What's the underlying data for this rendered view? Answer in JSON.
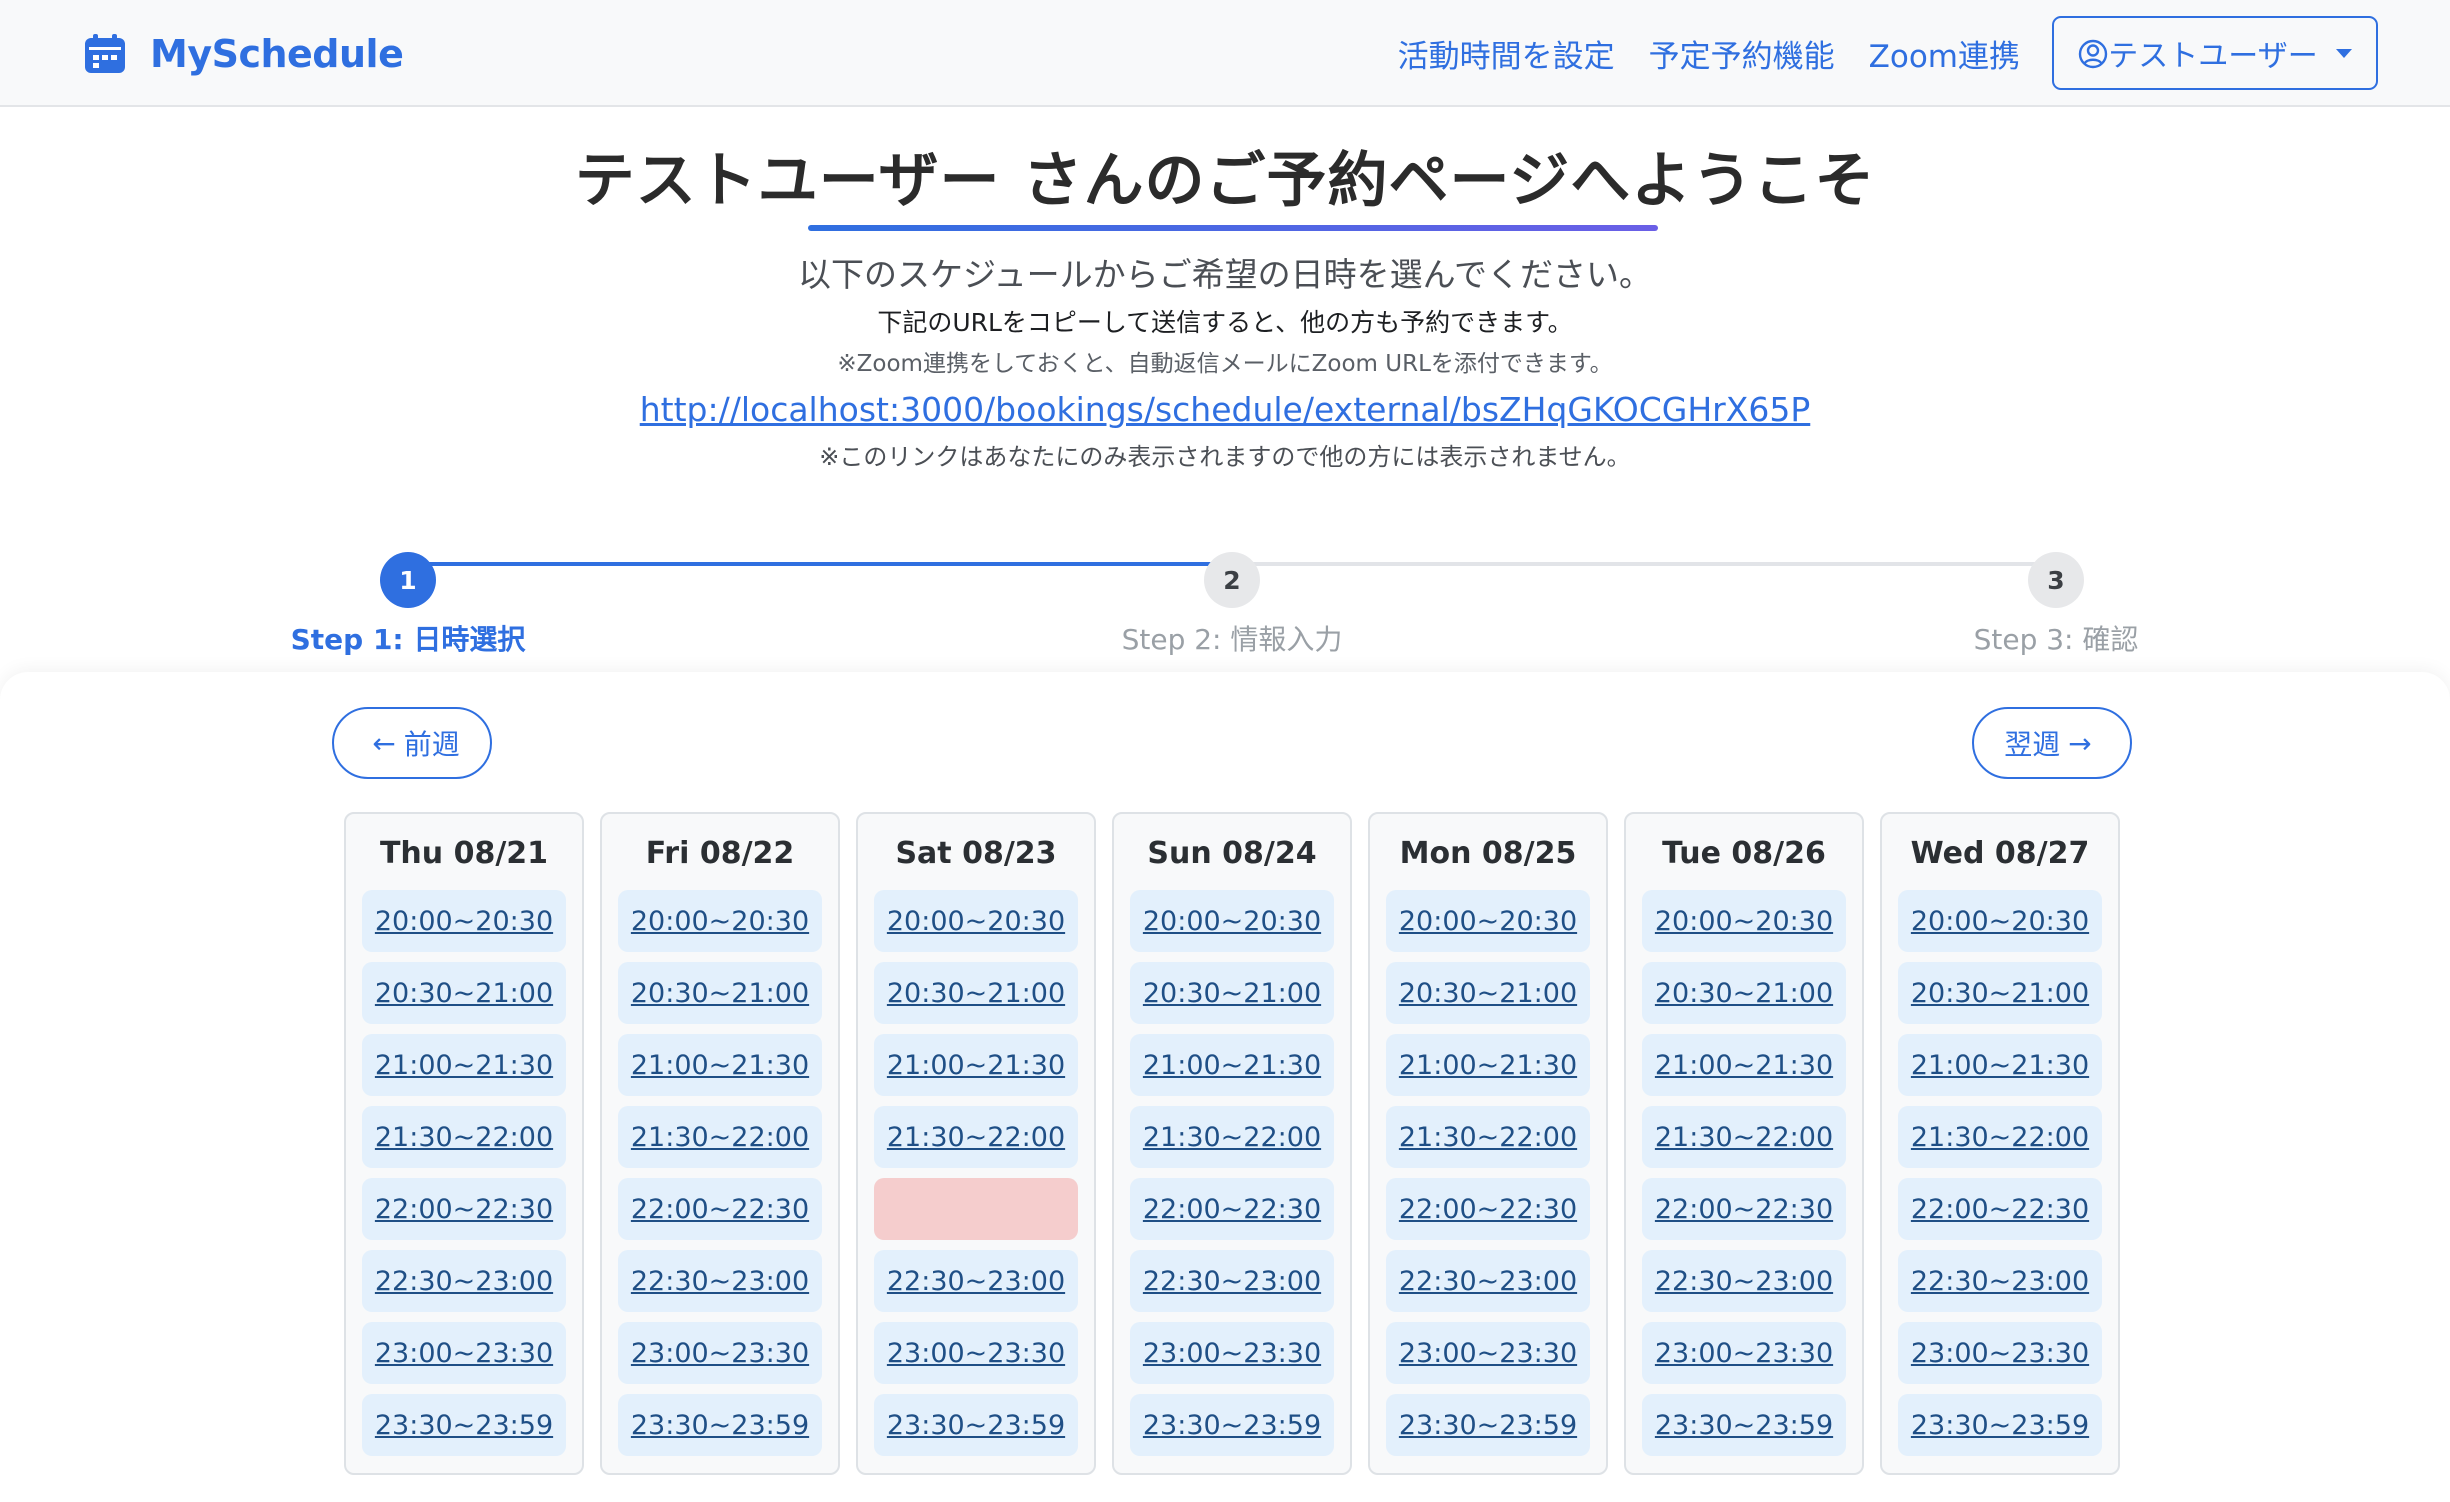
{
  "navbar": {
    "brand": "MySchedule",
    "links": [
      "活動時間を設定",
      "予定予約機能",
      "Zoom連携"
    ],
    "user_menu": "テストユーザー"
  },
  "header": {
    "title": "テストユーザー さんのご予約ページへようこそ",
    "subtitle": "以下のスケジュールからご希望の日時を選んでください。",
    "copy_note": "下記のURLをコピーして送信すると、他の方も予約できます。",
    "zoom_note": "※Zoom連携をしておくと、自動返信メールにZoom URLを添付できます。",
    "share_url": "http://localhost:3000/bookings/schedule/external/bsZHqGKOCGHrX65P",
    "link_note": "※このリンクはあなたにのみ表示されますので他の方には表示されません。"
  },
  "stepper": {
    "steps": [
      {
        "number": "1",
        "label": "Step 1: 日時選択",
        "state": "active"
      },
      {
        "number": "2",
        "label": "Step 2: 情報入力",
        "state": "inactive"
      },
      {
        "number": "3",
        "label": "Step 3: 確認",
        "state": "inactive"
      }
    ]
  },
  "week_nav": {
    "prev_label": "前週",
    "next_label": "翌週"
  },
  "schedule": {
    "days": [
      {
        "label": "Thu 08/21",
        "slots": [
          "20:00~20:30",
          "20:30~21:00",
          "21:00~21:30",
          "21:30~22:00",
          "22:00~22:30",
          "22:30~23:00",
          "23:00~23:30",
          "23:30~23:59"
        ],
        "booked": []
      },
      {
        "label": "Fri 08/22",
        "slots": [
          "20:00~20:30",
          "20:30~21:00",
          "21:00~21:30",
          "21:30~22:00",
          "22:00~22:30",
          "22:30~23:00",
          "23:00~23:30",
          "23:30~23:59"
        ],
        "booked": []
      },
      {
        "label": "Sat 08/23",
        "slots": [
          "20:00~20:30",
          "20:30~21:00",
          "21:00~21:30",
          "21:30~22:00",
          "",
          "22:30~23:00",
          "23:00~23:30",
          "23:30~23:59"
        ],
        "booked": [
          4
        ]
      },
      {
        "label": "Sun 08/24",
        "slots": [
          "20:00~20:30",
          "20:30~21:00",
          "21:00~21:30",
          "21:30~22:00",
          "22:00~22:30",
          "22:30~23:00",
          "23:00~23:30",
          "23:30~23:59"
        ],
        "booked": []
      },
      {
        "label": "Mon 08/25",
        "slots": [
          "20:00~20:30",
          "20:30~21:00",
          "21:00~21:30",
          "21:30~22:00",
          "22:00~22:30",
          "22:30~23:00",
          "23:00~23:30",
          "23:30~23:59"
        ],
        "booked": []
      },
      {
        "label": "Tue 08/26",
        "slots": [
          "20:00~20:30",
          "20:30~21:00",
          "21:00~21:30",
          "21:30~22:00",
          "22:00~22:30",
          "22:30~23:00",
          "23:00~23:30",
          "23:30~23:59"
        ],
        "booked": []
      },
      {
        "label": "Wed 08/27",
        "slots": [
          "20:00~20:30",
          "20:30~21:00",
          "21:00~21:30",
          "21:30~22:00",
          "22:00~22:30",
          "22:30~23:00",
          "23:00~23:30",
          "23:30~23:59"
        ],
        "booked": []
      }
    ]
  },
  "colors": {
    "primary": "#2f6fe0",
    "slot_available": "#e3f0fc",
    "slot_booked": "#f5cdcd"
  }
}
